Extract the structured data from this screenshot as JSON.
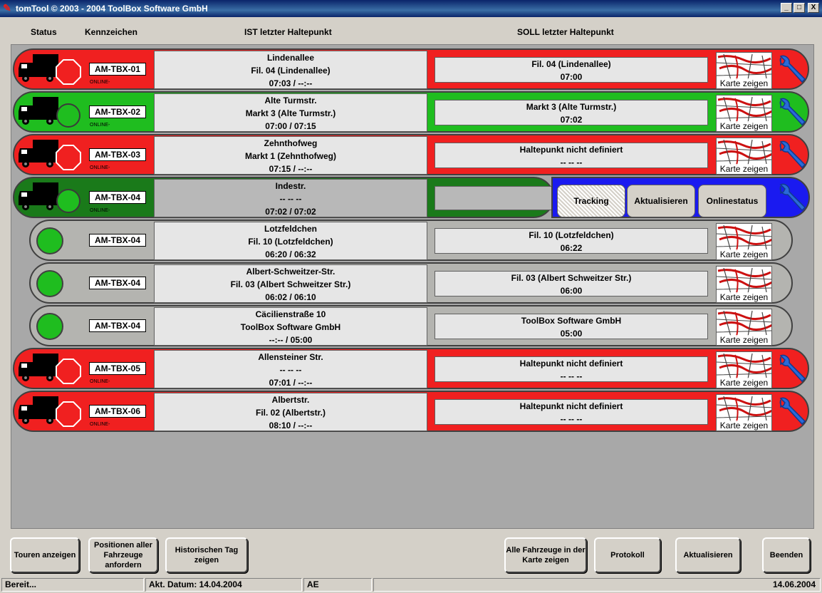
{
  "window": {
    "title": "tomTool © 2003 - 2004 ToolBox Software GmbH",
    "min": "_",
    "max": "□",
    "close": "X"
  },
  "headers": {
    "status": "Status",
    "kennzeichen": "Kennzeichen",
    "ist": "IST letzter Haltepunkt",
    "soll": "SOLL letzter Haltepunkt"
  },
  "karte_label": "Karte zeigen",
  "online_label": "ONLINE-",
  "rows": [
    {
      "plate": "AM-TBX-01",
      "status": "STOP",
      "ist": [
        "Lindenallee",
        "Fil. 04 (Lindenallee)",
        "07:03 / --:--"
      ],
      "soll": [
        "Fil. 04 (Lindenallee)",
        "07:00"
      ]
    },
    {
      "plate": "AM-TBX-02",
      "status": "GO",
      "ist": [
        "Alte Turmstr.",
        "Markt 3 (Alte Turmstr.)",
        "07:00 / 07:15"
      ],
      "soll": [
        "Markt 3 (Alte Turmstr.)",
        "07:02"
      ]
    },
    {
      "plate": "AM-TBX-03",
      "status": "STOP",
      "ist": [
        "Zehnthofweg",
        "Markt 1 (Zehnthofweg)",
        "07:15 / --:--"
      ],
      "soll": [
        "Haltepunkt nicht definiert",
        "-- -- --"
      ]
    },
    {
      "plate": "AM-TBX-04",
      "status": "GO",
      "ist": [
        "Indestr.",
        "-- -- --",
        "07:02 / 07:02"
      ]
    },
    {
      "plate": "AM-TBX-04",
      "ist": [
        "Lotzfeldchen",
        "Fil. 10 (Lotzfeldchen)",
        "06:20 / 06:32"
      ],
      "soll": [
        "Fil. 10 (Lotzfeldchen)",
        "06:22"
      ]
    },
    {
      "plate": "AM-TBX-04",
      "ist": [
        "Albert-Schweitzer-Str.",
        "Fil. 03 (Albert Schweitzer Str.)",
        "06:02 / 06:10"
      ],
      "soll": [
        "Fil. 03 (Albert Schweitzer Str.)",
        "06:00"
      ]
    },
    {
      "plate": "AM-TBX-04",
      "ist": [
        "Cäcilienstraße 10",
        "ToolBox Software GmbH",
        "--:-- / 05:00"
      ],
      "soll": [
        "ToolBox Software GmbH",
        "05:00"
      ]
    },
    {
      "plate": "AM-TBX-05",
      "status": "STOP",
      "ist": [
        "Allensteiner Str.",
        "-- -- --",
        "07:01 / --:--"
      ],
      "soll": [
        "Haltepunkt nicht definiert",
        "-- -- --"
      ]
    },
    {
      "plate": "AM-TBX-06",
      "status": "STOP",
      "ist": [
        "Albertstr.",
        "Fil. 02 (Albertstr.)",
        "08:10 / --:--"
      ],
      "soll": [
        "Haltepunkt nicht definiert",
        "-- -- --"
      ]
    }
  ],
  "expanded_panel": {
    "tracking": "Tracking",
    "aktualisieren": "Aktualisieren",
    "onlinestatus": "Onlinestatus"
  },
  "bottom_buttons": {
    "touren": "Touren anzeigen",
    "positionen": "Positionen aller Fahrzeuge anfordern",
    "historisch": "Historischen Tag zeigen",
    "alle_karte": "Alle Fahrzeuge in der Karte zeigen",
    "protokoll": "Protokoll",
    "aktualisieren": "Aktualisieren",
    "beenden": "Beenden"
  },
  "statusbar": {
    "ready": "Bereit...",
    "datum": "Akt. Datum: 14.04.2004",
    "mode": "AE",
    "date_right": "14.06.2004"
  },
  "colors": {
    "green": "#1fbd1f",
    "red": "#f02020",
    "dark_green": "#1a7a1a",
    "blue": "#1a1af0",
    "gray": "#b4b4b0"
  }
}
